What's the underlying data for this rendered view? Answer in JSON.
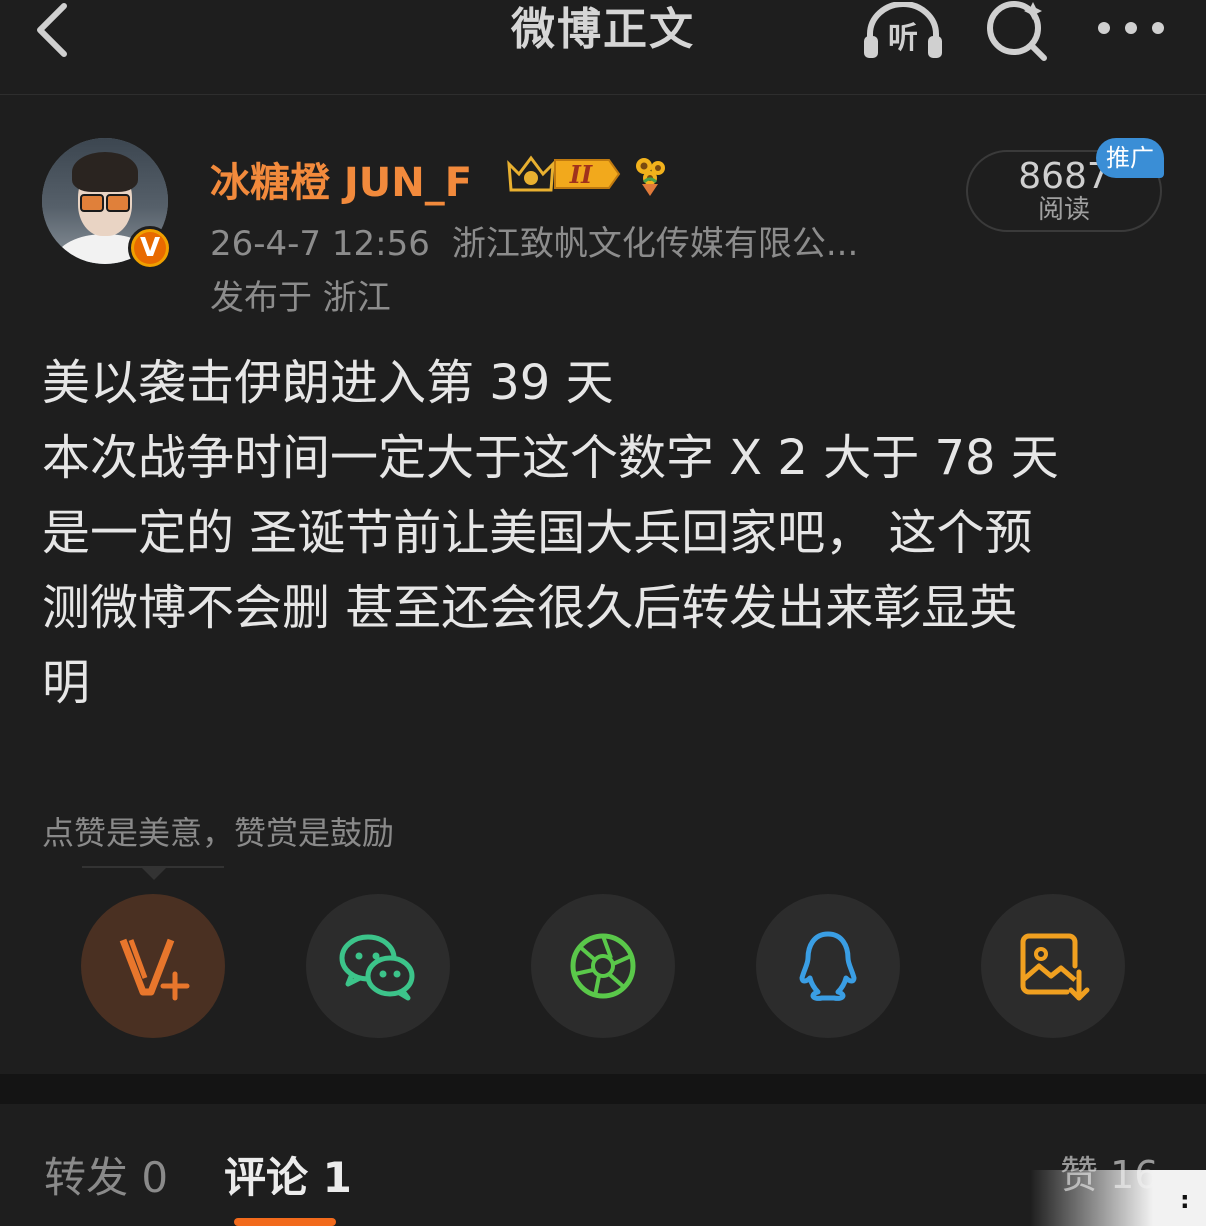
{
  "header": {
    "title": "微博正文",
    "listen_label": "听"
  },
  "post": {
    "author": {
      "name": "冰糖橙 JUN_F",
      "verified_badge": "V",
      "level_badge": "II"
    },
    "time": "26-4-7 12:56",
    "source": "浙江致帆文化传媒有限公...",
    "location": "发布于 浙江",
    "reads": {
      "count": "8687",
      "label": "阅读",
      "promo_tag": "推广"
    },
    "content": [
      "美以袭击伊朗进入第 39 天",
      "本次战争时间一定大于这个数字 X 2 大于 78 天",
      "是一定的 圣诞节前让美国大兵回家吧， 这个预",
      "测微博不会删 甚至还会很久后转发出来彰显英",
      "明"
    ]
  },
  "reward_tip": "点赞是美意，赞赏是鼓励",
  "share": [
    {
      "icon": "v-plus-icon",
      "color": "#e8762c"
    },
    {
      "icon": "wechat-icon",
      "color": "#3cc48a"
    },
    {
      "icon": "moments-icon",
      "color": "#5ac84a"
    },
    {
      "icon": "qq-icon",
      "color": "#3a9ee4"
    },
    {
      "icon": "save-image-icon",
      "color": "#f0a020"
    }
  ],
  "tabs": {
    "repost": "转发 0",
    "comment": "评论 1",
    "likes": "赞 16"
  },
  "colors": {
    "background": "#1e1e1e",
    "accent": "#f26a1c",
    "username": "#f28a3c",
    "promo": "#3a8ed6"
  }
}
